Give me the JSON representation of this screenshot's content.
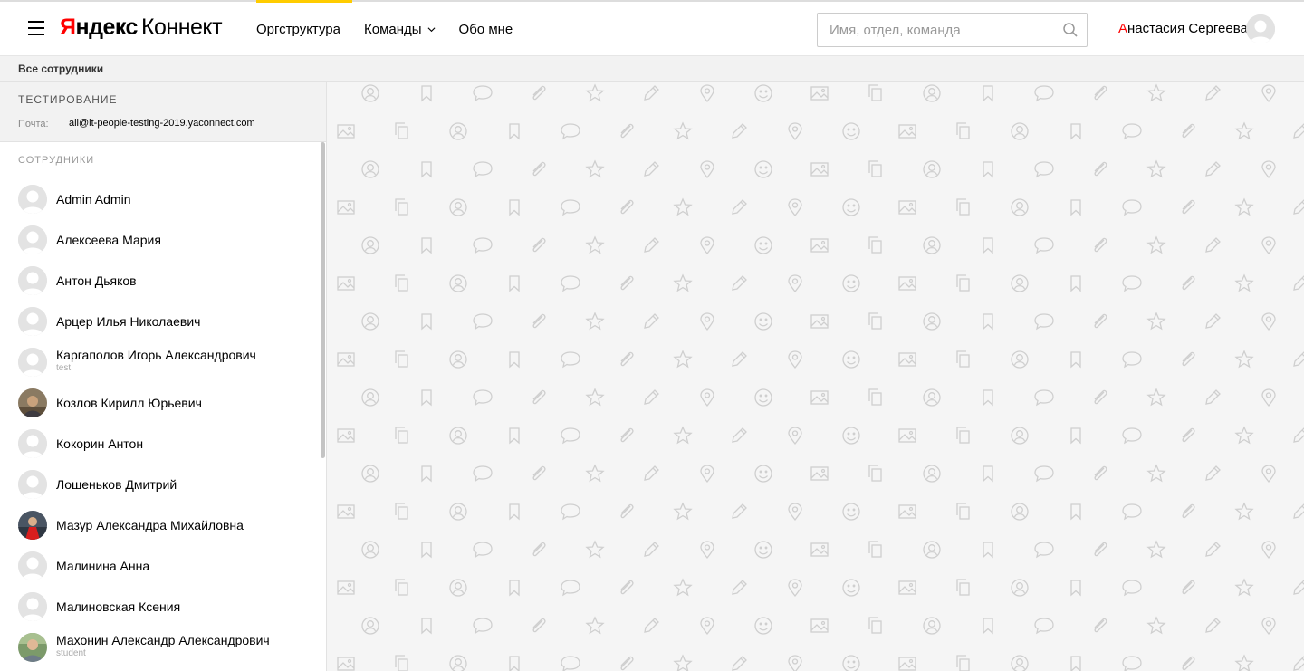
{
  "header": {
    "logo": {
      "part1": "Я",
      "part2": "ндекс",
      "part3": "Коннект"
    },
    "nav": [
      {
        "label": "Оргструктура"
      },
      {
        "label": "Команды"
      },
      {
        "label": "Обо мне"
      }
    ],
    "search": {
      "placeholder": "Имя, отдел, команда",
      "value": ""
    },
    "user": {
      "first_letter": "А",
      "rest": "настасия Сергеева"
    },
    "accent_color": "#ffcc00"
  },
  "breadcrumb": {
    "label": "Все сотрудники"
  },
  "department": {
    "title": "ТЕСТИРОВАНИЕ",
    "mail_label": "Почта:",
    "mail": "all@it-people-testing-2019.yaconnect.com"
  },
  "employees": {
    "section_title": "СОТРУДНИКИ",
    "items": [
      {
        "name": "Admin Admin",
        "sub": "",
        "avatar": "placeholder"
      },
      {
        "name": "Алексеева Мария",
        "sub": "",
        "avatar": "placeholder"
      },
      {
        "name": "Антон Дьяков",
        "sub": "",
        "avatar": "placeholder"
      },
      {
        "name": "Арцер Илья Николаевич",
        "sub": "",
        "avatar": "placeholder"
      },
      {
        "name": "Каргаполов Игорь Александрович",
        "sub": "test",
        "avatar": "placeholder"
      },
      {
        "name": "Козлов Кирилл Юрьевич",
        "sub": "",
        "avatar": "photo"
      },
      {
        "name": "Кокорин Антон",
        "sub": "",
        "avatar": "placeholder"
      },
      {
        "name": "Лошеньков Дмитрий",
        "sub": "",
        "avatar": "placeholder"
      },
      {
        "name": "Мазур Александра Михайловна",
        "sub": "",
        "avatar": "photo"
      },
      {
        "name": "Малинина Анна",
        "sub": "",
        "avatar": "placeholder"
      },
      {
        "name": "Малиновская Ксения",
        "sub": "",
        "avatar": "placeholder"
      },
      {
        "name": "Махонин Александр Александрович",
        "sub": "student",
        "avatar": "photo"
      }
    ]
  },
  "pattern_icons": [
    "user-icon",
    "bookmark-icon",
    "comment-icon",
    "paperclip-icon",
    "star-icon",
    "pencil-icon",
    "pin-icon",
    "smile-icon",
    "image-icon",
    "copy-icon"
  ]
}
